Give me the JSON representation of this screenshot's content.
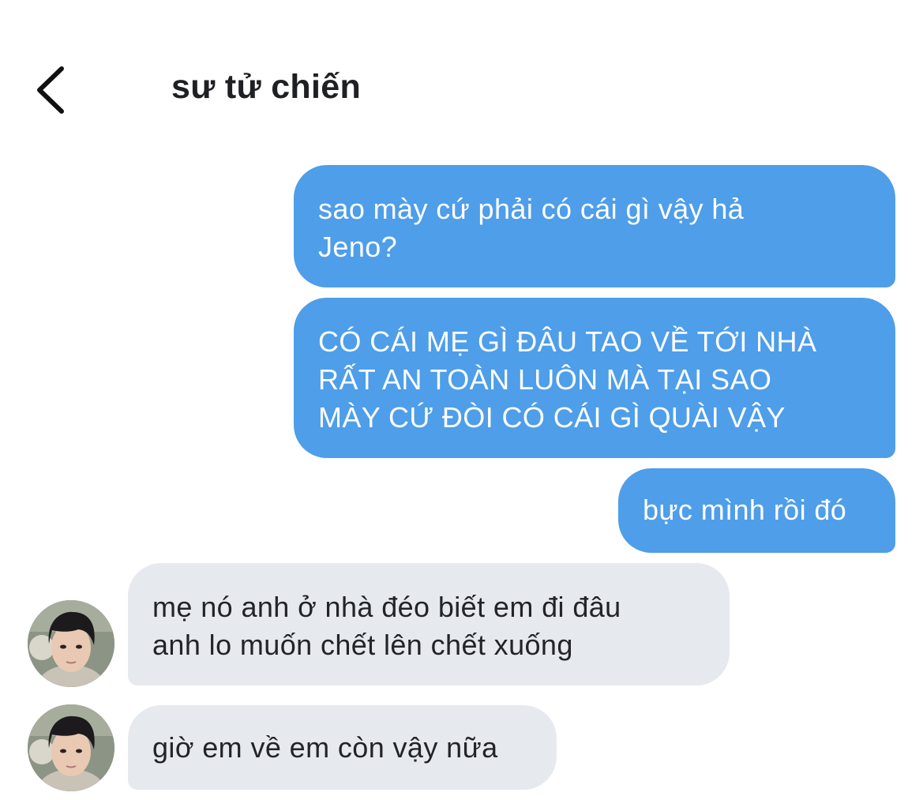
{
  "header": {
    "back_icon": "chevron-left-icon",
    "title": "sư tử chiến"
  },
  "messages": [
    {
      "direction": "outgoing",
      "text": "sao mày cứ phải có cái gì vậy hả\nJeno?"
    },
    {
      "direction": "outgoing",
      "text": "CÓ CÁI MẸ GÌ ĐÂU TAO VỀ TỚI NHÀ\nRẤT AN TOÀN LUÔN MÀ TẠI SAO\nMÀY CỨ ĐÒI CÓ CÁI GÌ QUÀI VẬY"
    },
    {
      "direction": "outgoing",
      "text": "bực mình rồi đó"
    },
    {
      "direction": "incoming",
      "text": "mẹ nó anh ở nhà đéo biết em đi đâu\nanh lo muốn chết lên chết xuống"
    },
    {
      "direction": "incoming",
      "text": "giờ em về em còn vậy nữa"
    }
  ],
  "colors": {
    "outgoing_bubble": "#4e9ee9",
    "incoming_bubble": "#e6e9ee",
    "outgoing_text": "#ffffff",
    "incoming_text": "#222428"
  }
}
